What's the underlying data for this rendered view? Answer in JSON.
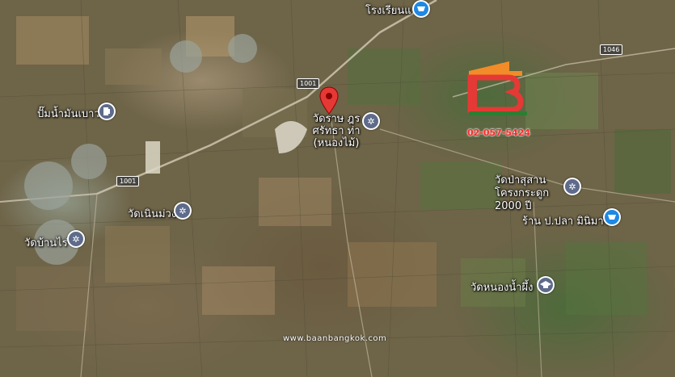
{
  "map": {
    "places": [
      {
        "name": "โรงเรียนแ",
        "kind": "shopping"
      },
      {
        "name": "ปั๊มน้ำมันเบาวร์",
        "kind": "fuel"
      },
      {
        "name": "วัดราษ ฎรศรัทธา ท่า (หนองไม้)",
        "kind": "temple"
      },
      {
        "name": "วัดเนินม่วง",
        "kind": "temple"
      },
      {
        "name": "วัดบ้านไร่",
        "kind": "temple"
      },
      {
        "name": "วัดป่าสุสานโครงกระดูก 2000 ปี",
        "kind": "temple"
      },
      {
        "name": "ร้าน ป.ปลา มินิมาร์ท",
        "kind": "shopping"
      },
      {
        "name": "วัดหนองน้ำผึ้ง",
        "kind": "education"
      }
    ],
    "road_labels": [
      "1001",
      "1001",
      "1046"
    ]
  },
  "overlay": {
    "phone": "02-057-5424",
    "website": "www.baanbangkok.com"
  },
  "colors": {
    "pin_red": "#e53935",
    "label_white": "#ffffff",
    "temple_icon": "#5e6b8a",
    "shop_icon": "#1e88e5",
    "logo_red": "#e53935",
    "logo_green": "#2e7d32",
    "logo_orange": "#f28c28"
  },
  "icons": [
    "location-pin-icon",
    "temple-icon",
    "shopping-icon",
    "fuel-icon",
    "education-icon"
  ]
}
